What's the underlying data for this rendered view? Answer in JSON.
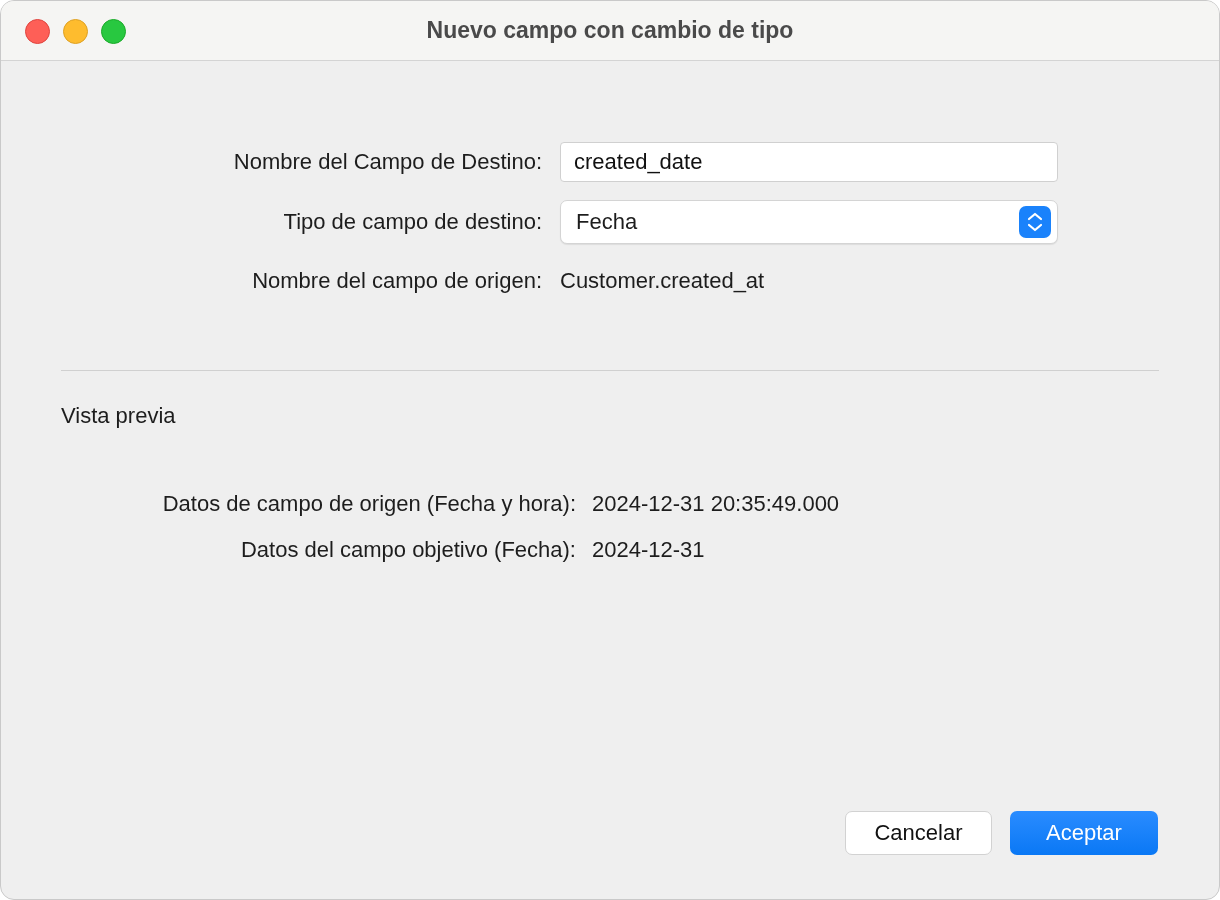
{
  "window": {
    "title": "Nuevo campo con cambio de tipo"
  },
  "form": {
    "target_name": {
      "label": "Nombre del Campo de Destino:",
      "value": "created_date"
    },
    "target_type": {
      "label": "Tipo de campo de destino:",
      "value": "Fecha"
    },
    "source_name": {
      "label": "Nombre del campo de origen:",
      "value": "Customer.created_at"
    }
  },
  "preview": {
    "heading": "Vista previa",
    "rows": [
      {
        "label": "Datos de campo de origen (Fecha y hora):",
        "value": "2024-12-31 20:35:49.000"
      },
      {
        "label": "Datos del campo objetivo (Fecha):",
        "value": "2024-12-31"
      }
    ]
  },
  "buttons": [
    {
      "label": "Cancelar",
      "kind": "secondary"
    },
    {
      "label": "Aceptar",
      "kind": "primary"
    }
  ]
}
